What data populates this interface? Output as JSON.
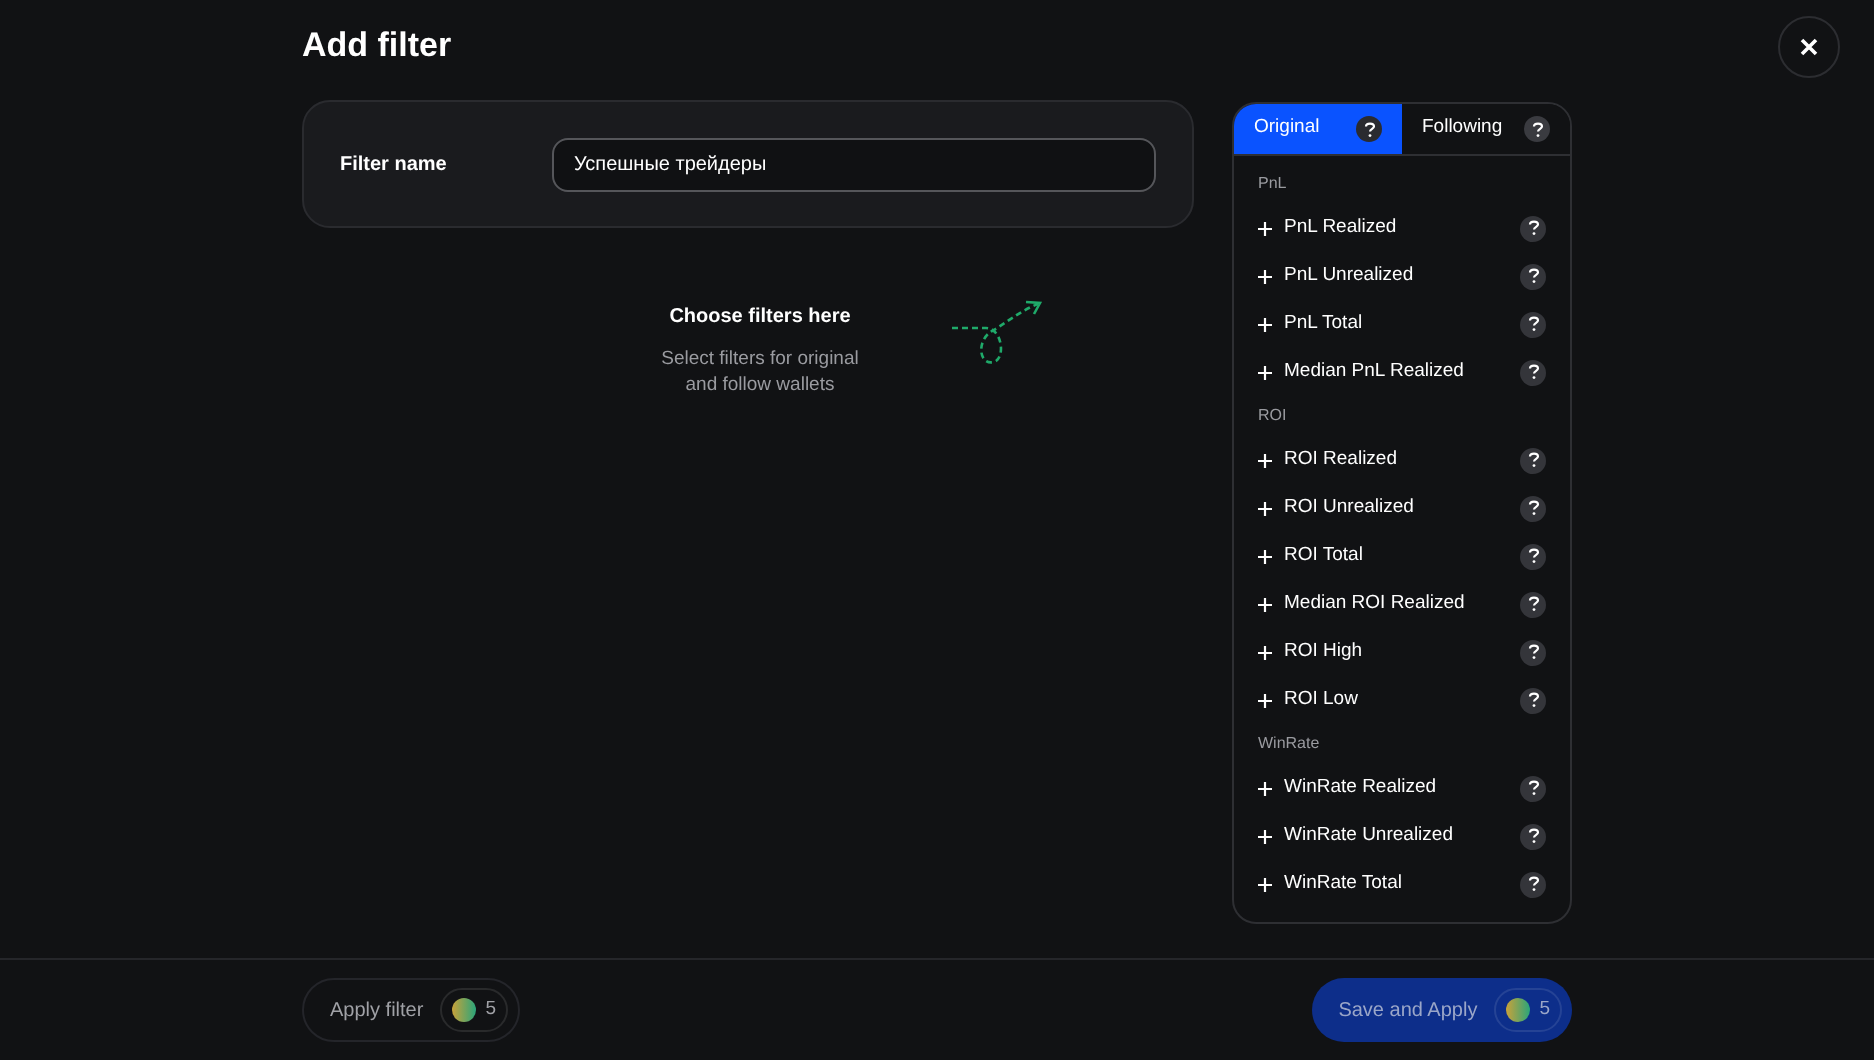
{
  "title": "Add filter",
  "filter_name": {
    "label": "Filter name",
    "value": "Успешные трейдеры"
  },
  "empty_state": {
    "heading": "Choose filters here",
    "text": "Select filters for original and follow wallets"
  },
  "tabs": [
    {
      "label": "Original",
      "selected": true
    },
    {
      "label": "Following",
      "selected": false
    }
  ],
  "groups": [
    {
      "title": "PnL",
      "items": [
        "PnL Realized",
        "PnL Unrealized",
        "PnL Total",
        "Median PnL Realized"
      ]
    },
    {
      "title": "ROI",
      "items": [
        "ROI Realized",
        "ROI Unrealized",
        "ROI Total",
        "Median ROI Realized",
        "ROI High",
        "ROI Low"
      ]
    },
    {
      "title": "WinRate",
      "items": [
        "WinRate Realized",
        "WinRate Unrealized",
        "WinRate Total"
      ]
    }
  ],
  "footer": {
    "buttons": [
      {
        "kind": "secondary",
        "label": "Apply filter",
        "count": "5",
        "disabled": true
      },
      {
        "kind": "primary",
        "label": "Save and Apply",
        "count": "5",
        "disabled": true
      }
    ]
  }
}
